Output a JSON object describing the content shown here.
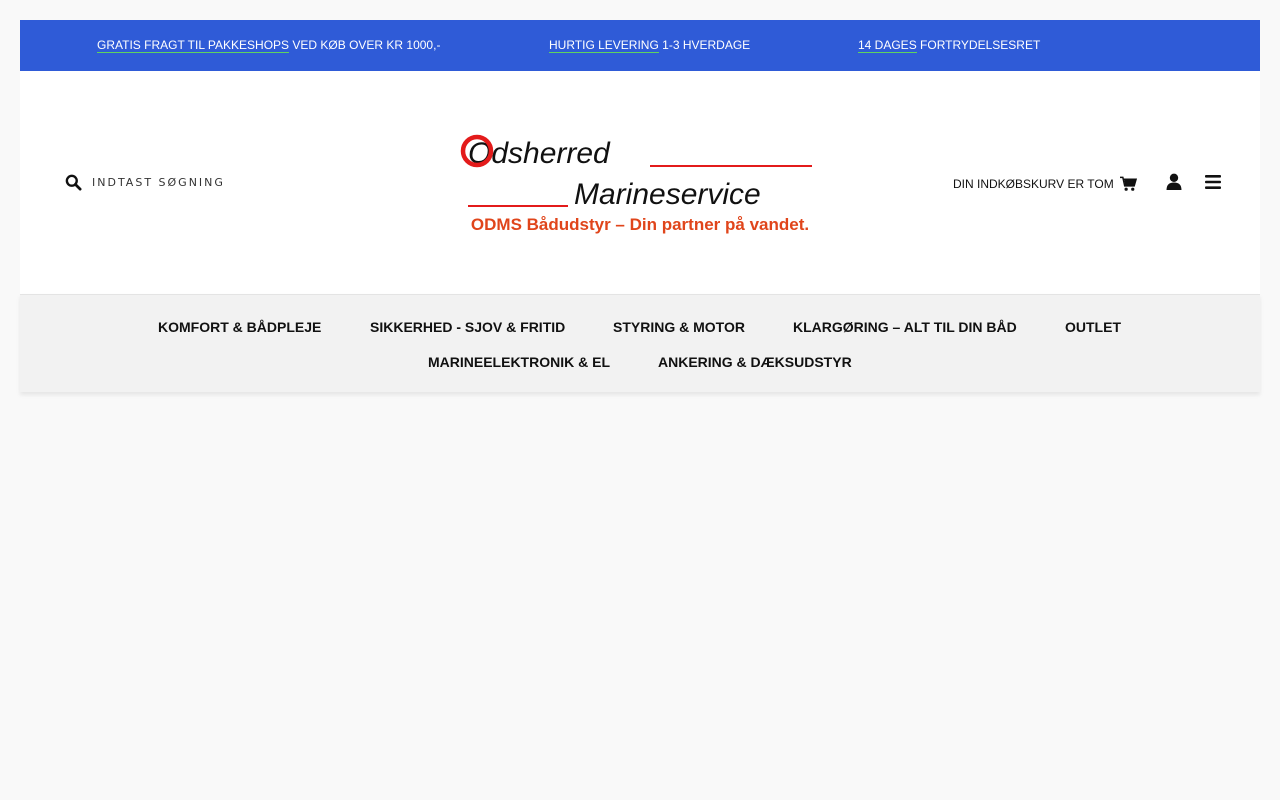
{
  "promo": [
    {
      "highlight": "GRATIS FRAGT TIL PAKKESHOPS",
      "rest": " VED KØB OVER KR 1000,-"
    },
    {
      "highlight": "HURTIG LEVERING",
      "rest": " 1-3 HVERDAGE"
    },
    {
      "highlight": "14 DAGES",
      "rest": " FORTRYDELSESRET"
    }
  ],
  "search": {
    "placeholder": "INDTAST SØGNING",
    "icon": "search-icon"
  },
  "logo": {
    "line1": "Odsherred",
    "line2": "Marineservice",
    "tagline": "ODMS Bådudstyr – Din partner på vandet."
  },
  "cart": {
    "label": "DIN INDKØBSKURV ER TOM",
    "icon": "cart-icon"
  },
  "icons": {
    "user": "user-icon",
    "menu": "menu-icon"
  },
  "nav": {
    "items": [
      "KOMFORT & BÅDPLEJE",
      "SIKKERHED - SJOV & FRITID",
      "STYRING & MOTOR",
      "KLARGØRING – ALT TIL DIN BÅD",
      "OUTLET",
      "MARINEELEKTRONIK & EL",
      "ANKERING & DÆKSUDSTYR"
    ]
  },
  "colors": {
    "promo_bg": "#2f5bd7",
    "promo_underline": "#5fd35f",
    "logo_red": "#e31b1b",
    "logo_tagline": "#e0451b",
    "nav_bg": "#f2f2f2"
  }
}
